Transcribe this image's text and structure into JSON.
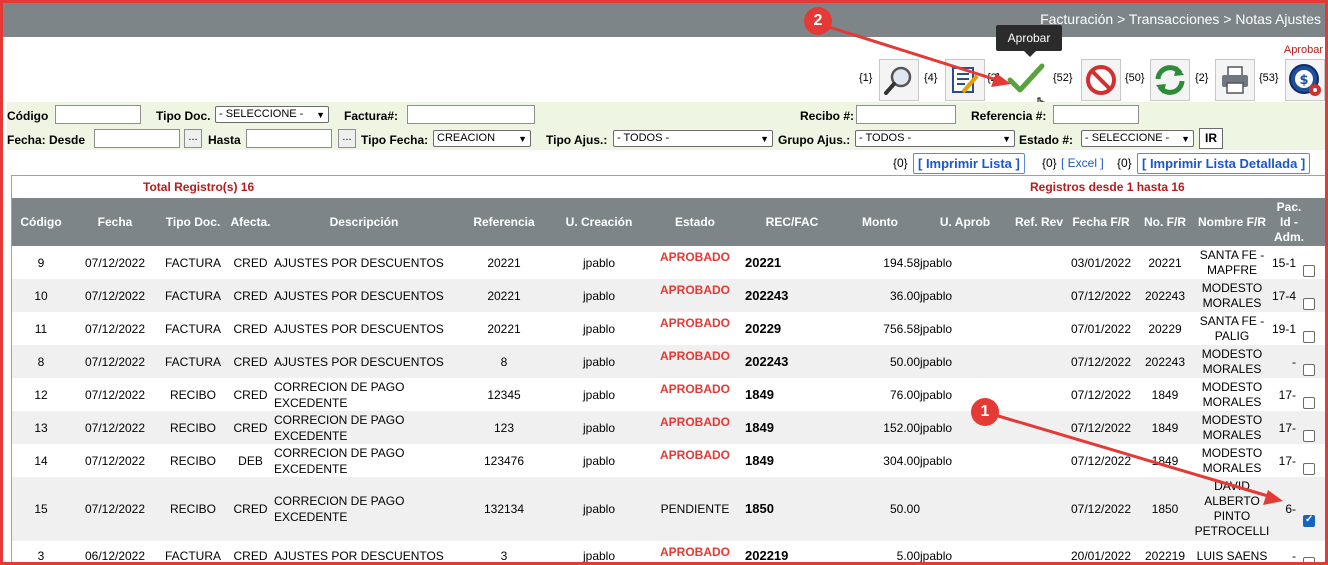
{
  "breadcrumb": "Facturación > Transacciones > Notas Ajustes",
  "tooltip": "Aprobar",
  "aprobar_label": "Aprobar",
  "toolbar": {
    "counts": [
      "{1}",
      "{4}",
      "{2}",
      "{52}",
      "{50}",
      "{2}",
      "{53}"
    ]
  },
  "filters": {
    "codigo": "Código",
    "tipo_doc": "Tipo Doc.",
    "tipo_doc_value": "- SELECCIONE -",
    "factura": "Factura#:",
    "recibo": "Recibo #:",
    "referencia": "Referencia #:",
    "fecha_desde": "Fecha: Desde",
    "hasta": "Hasta",
    "tipo_fecha": "Tipo Fecha:",
    "tipo_fecha_value": "CREACION",
    "tipo_ajus": "Tipo Ajus.:",
    "tipo_ajus_value": "- TODOS -",
    "grupo_ajus": "Grupo Ajus.:",
    "grupo_ajus_value": "- TODOS -",
    "estado": "Estado #:",
    "estado_value": "- SELECCIONE -",
    "ellipsis": "...",
    "ir": "IR"
  },
  "print": {
    "c1": "{0}",
    "imprimir_lista": "[ Imprimir Lista ]",
    "c2": "{0}",
    "excel": "[ Excel ]",
    "c3": "{0}",
    "imprimir_detallada": "[ Imprimir Lista Detallada ]"
  },
  "totals": {
    "total": "Total Registro(s) 16",
    "range": "Registros desde 1 hasta 16"
  },
  "table": {
    "headers": [
      "Código",
      "Fecha",
      "Tipo Doc.",
      "Afecta.",
      "Descripción",
      "Referencia",
      "U. Creación",
      "Estado",
      "REC/FAC",
      "Monto",
      "U. Aprob",
      "Ref. Rev",
      "Fecha F/R",
      "No. F/R",
      "Nombre F/R",
      "Pac. Id - Adm."
    ],
    "rows": [
      {
        "codigo": "9",
        "fecha": "07/12/2022",
        "tipo": "FACTURA",
        "afecta": "CRED",
        "desc1": "AJUSTES POR DESCUENTOS",
        "desc2": "",
        "ref": "20221",
        "ucre": "jpablo",
        "estado": "APROBADO",
        "recfac": "20221",
        "monto": "194.58",
        "uapr": "jpablo",
        "fecfr": "03/01/2022",
        "nofr": "20221",
        "nom": [
          "SANTA FE -",
          "MAPFRE"
        ],
        "pac": "15-1",
        "checked": false
      },
      {
        "codigo": "10",
        "fecha": "07/12/2022",
        "tipo": "FACTURA",
        "afecta": "CRED",
        "desc1": "AJUSTES POR DESCUENTOS",
        "desc2": "",
        "ref": "20221",
        "ucre": "jpablo",
        "estado": "APROBADO",
        "recfac": "202243",
        "monto": "36.00",
        "uapr": "jpablo",
        "fecfr": "07/12/2022",
        "nofr": "202243",
        "nom": [
          "MODESTO",
          "MORALES"
        ],
        "pac": "17-4",
        "checked": false
      },
      {
        "codigo": "11",
        "fecha": "07/12/2022",
        "tipo": "FACTURA",
        "afecta": "CRED",
        "desc1": "AJUSTES POR DESCUENTOS",
        "desc2": "",
        "ref": "20221",
        "ucre": "jpablo",
        "estado": "APROBADO",
        "recfac": "20229",
        "monto": "756.58",
        "uapr": "jpablo",
        "fecfr": "07/01/2022",
        "nofr": "20229",
        "nom": [
          "SANTA FE -",
          "PALIG"
        ],
        "pac": "19-1",
        "checked": false
      },
      {
        "codigo": "8",
        "fecha": "07/12/2022",
        "tipo": "FACTURA",
        "afecta": "CRED",
        "desc1": "AJUSTES POR DESCUENTOS",
        "desc2": "",
        "ref": "8",
        "ucre": "jpablo",
        "estado": "APROBADO",
        "recfac": "202243",
        "monto": "50.00",
        "uapr": "jpablo",
        "fecfr": "07/12/2022",
        "nofr": "202243",
        "nom": [
          "MODESTO",
          "MORALES"
        ],
        "pac": "-",
        "checked": false
      },
      {
        "codigo": "12",
        "fecha": "07/12/2022",
        "tipo": "RECIBO",
        "afecta": "CRED",
        "desc1": "CORRECION DE PAGO",
        "desc2": "EXCEDENTE",
        "ref": "12345",
        "ucre": "jpablo",
        "estado": "APROBADO",
        "recfac": "1849",
        "monto": "76.00",
        "uapr": "jpablo",
        "fecfr": "07/12/2022",
        "nofr": "1849",
        "nom": [
          "MODESTO",
          "MORALES"
        ],
        "pac": "17-",
        "checked": false
      },
      {
        "codigo": "13",
        "fecha": "07/12/2022",
        "tipo": "RECIBO",
        "afecta": "CRED",
        "desc1": "CORRECION DE PAGO",
        "desc2": "EXCEDENTE",
        "ref": "123",
        "ucre": "jpablo",
        "estado": "APROBADO",
        "recfac": "1849",
        "monto": "152.00",
        "uapr": "jpablo",
        "fecfr": "07/12/2022",
        "nofr": "1849",
        "nom": [
          "MODESTO",
          "MORALES"
        ],
        "pac": "17-",
        "checked": false
      },
      {
        "codigo": "14",
        "fecha": "07/12/2022",
        "tipo": "RECIBO",
        "afecta": "DEB",
        "desc1": "CORRECION DE PAGO",
        "desc2": "EXCEDENTE",
        "ref": "123476",
        "ucre": "jpablo",
        "estado": "APROBADO",
        "recfac": "1849",
        "monto": "304.00",
        "uapr": "jpablo",
        "fecfr": "07/12/2022",
        "nofr": "1849",
        "nom": [
          "MODESTO",
          "MORALES"
        ],
        "pac": "17-",
        "checked": false
      },
      {
        "codigo": "15",
        "fecha": "07/12/2022",
        "tipo": "RECIBO",
        "afecta": "CRED",
        "desc1": "CORRECION DE PAGO",
        "desc2": "EXCEDENTE",
        "ref": "132134",
        "ucre": "jpablo",
        "estado": "PENDIENTE",
        "recfac": "1850",
        "monto": "50.00",
        "uapr": "",
        "fecfr": "07/12/2022",
        "nofr": "1850",
        "nom": [
          "DAVID",
          "ALBERTO",
          "PINTO",
          "PETROCELLI"
        ],
        "pac": "6-",
        "checked": true
      },
      {
        "codigo": "3",
        "fecha": "06/12/2022",
        "tipo": "FACTURA",
        "afecta": "CRED",
        "desc1": "AJUSTES POR DESCUENTOS",
        "desc2": "",
        "ref": "3",
        "ucre": "jpablo",
        "estado": "APROBADO",
        "recfac": "202219",
        "monto": "5.00",
        "uapr": "jpablo",
        "fecfr": "20/01/2022",
        "nofr": "202219",
        "nom": [
          "LUIS SAENS"
        ],
        "pac": "-",
        "checked": false
      }
    ]
  },
  "annotations": {
    "badge1": "1",
    "badge2": "2"
  }
}
